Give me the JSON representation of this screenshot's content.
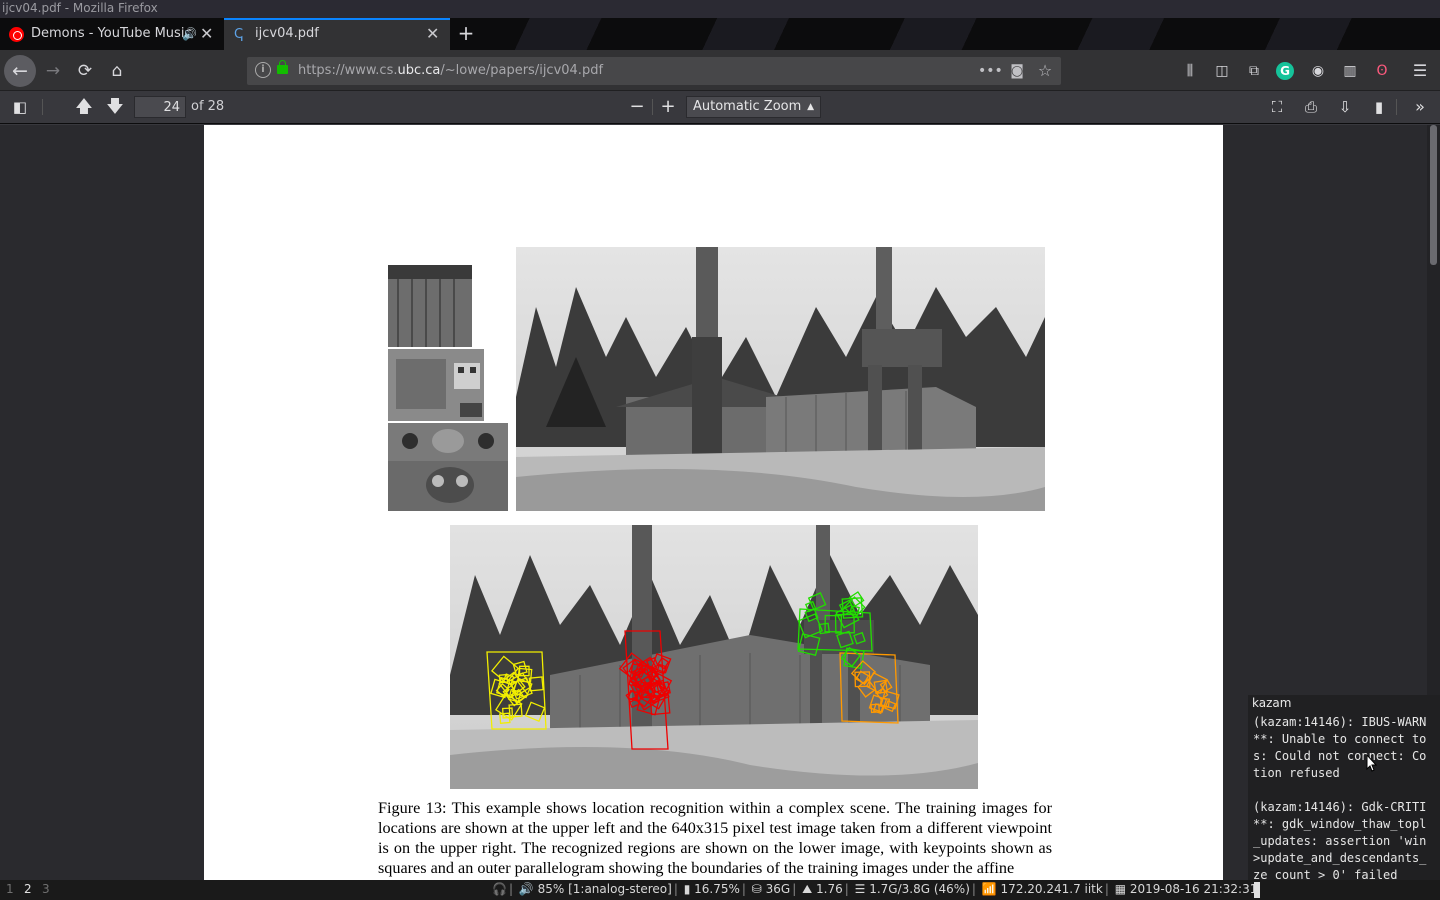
{
  "window": {
    "title": "ijcv04.pdf - Mozilla Firefox"
  },
  "tabs": [
    {
      "label": "Demons - YouTube Music",
      "icon": "youtube-music-icon",
      "audio_icon": "🔊"
    },
    {
      "label": "ijcv04.pdf",
      "icon": "pdf-icon",
      "active": true
    }
  ],
  "navbar": {
    "url_prefix": "https://www.cs.",
    "url_domain": "ubc.ca",
    "url_path": "/~lowe/papers/ijcv04.pdf",
    "accent": "#0a84ff"
  },
  "pdf_toolbar": {
    "page_number": "24",
    "page_of": "of 28",
    "zoom": "Automatic Zoom"
  },
  "document": {
    "caption": "Figure 13: This example shows location recognition within a complex scene. The training images for locations are shown at the upper left and the 640x315 pixel test image taken from a different viewpoint is on the upper right.  The recognized regions are shown on the lower image, with keypoints shown as squares and an outer parallelogram showing the boundaries of the training images under the affine",
    "region_colors": {
      "yellow": "#f2ee00",
      "red": "#ee0000",
      "green": "#22dd00",
      "orange": "#ff9900"
    }
  },
  "terminal": {
    "title": "kazam",
    "lines": "(kazam:14146): IBUS-WARN\n**: Unable to connect to\ns: Could not connect: Co\ntion refused\n\n(kazam:14146): Gdk-CRITI\n**: gdk_window_thaw_topl\n_updates: assertion 'win\n>update_and_descendants_\nze_count > 0' failed"
  },
  "statusbar": {
    "workspaces": [
      "1",
      "2",
      "3"
    ],
    "active_workspace": "2",
    "volume": "85% [1:analog-stereo]",
    "battery": "16.75%",
    "disk": "36G",
    "load": "1.76",
    "memory": "1.7G/3.8G (46%)",
    "network": "172.20.241.7 iitk",
    "datetime": "2019-08-16 21:32:31"
  }
}
